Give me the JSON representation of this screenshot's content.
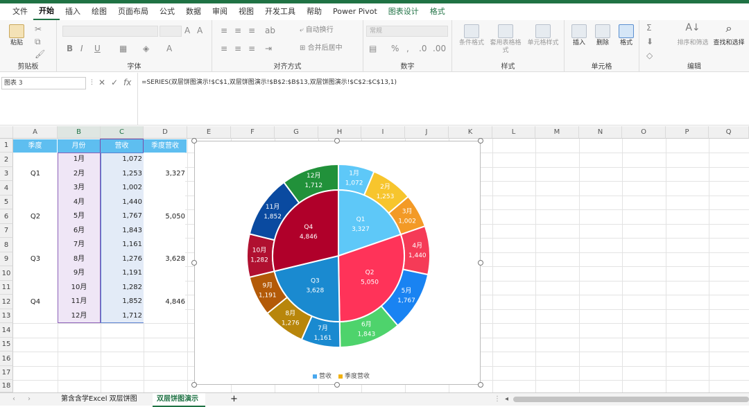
{
  "tabs": [
    "文件",
    "开始",
    "插入",
    "绘图",
    "页面布局",
    "公式",
    "数据",
    "审阅",
    "视图",
    "开发工具",
    "帮助",
    "Power Pivot",
    "图表设计",
    "格式"
  ],
  "active_tab": "开始",
  "ribbon": {
    "groups": [
      "剪贴板",
      "字体",
      "对齐方式",
      "数字",
      "样式",
      "单元格",
      "编辑"
    ],
    "paste_label": "粘贴",
    "wrap_text": "自动换行",
    "merge_center": "合并后居中",
    "number_format": "常规",
    "cond_format": "条件格式",
    "table_format": "套用表格格式",
    "cell_style": "单元格样式",
    "insert": "插入",
    "delete": "删除",
    "format": "格式",
    "sort_filter": "排序和筛选",
    "find_select": "查找和选择"
  },
  "formula_bar": {
    "name_box": "图表 3",
    "formula": "=SERIES(双层饼图演示!$C$1,双层饼图演示!$B$2:$B$13,双层饼图演示!$C$2:$C$13,1)"
  },
  "columns": [
    "A",
    "B",
    "C",
    "D",
    "E",
    "F",
    "G",
    "H",
    "I",
    "J",
    "K",
    "L",
    "M",
    "N",
    "O",
    "P",
    "Q"
  ],
  "rows": [
    "1",
    "2",
    "3",
    "4",
    "5",
    "6",
    "7",
    "8",
    "9",
    "10",
    "11",
    "12",
    "13",
    "14",
    "15",
    "16",
    "17",
    "18"
  ],
  "table": {
    "headers": [
      "季度",
      "月份",
      "营收",
      "季度营收"
    ],
    "months": [
      "1月",
      "2月",
      "3月",
      "4月",
      "5月",
      "6月",
      "7月",
      "8月",
      "9月",
      "10月",
      "11月",
      "12月"
    ],
    "revenue": [
      "1,072",
      "1,253",
      "1,002",
      "1,440",
      "1,767",
      "1,843",
      "1,161",
      "1,276",
      "1,191",
      "1,282",
      "1,852",
      "1,712"
    ],
    "quarters": [
      "Q1",
      "Q2",
      "Q3",
      "Q4"
    ],
    "quarter_revenue": [
      "3,327",
      "5,050",
      "3,628",
      "4,846"
    ]
  },
  "chart_data": {
    "type": "pie",
    "series": [
      {
        "name": "营收",
        "categories": [
          "1月",
          "2月",
          "3月",
          "4月",
          "5月",
          "6月",
          "7月",
          "8月",
          "9月",
          "10月",
          "11月",
          "12月"
        ],
        "values": [
          1072,
          1253,
          1002,
          1440,
          1767,
          1843,
          1161,
          1276,
          1191,
          1282,
          1852,
          1712
        ],
        "labels": [
          "1,072",
          "1,253",
          "1,002",
          "1,440",
          "1,767",
          "1,843",
          "1,161",
          "1,276",
          "1,191",
          "1,282",
          "1,852",
          "1,712"
        ]
      },
      {
        "name": "季度营收",
        "categories": [
          "Q1",
          "Q2",
          "Q3",
          "Q4"
        ],
        "values": [
          3327,
          5050,
          3628,
          4846
        ],
        "labels": [
          "3,327",
          "5,050",
          "3,628",
          "4,846"
        ]
      }
    ],
    "legend": [
      "营收",
      "季度营收"
    ],
    "legend_position": "bottom",
    "outer_colors": [
      "#5ec8f8",
      "#f7c52d",
      "#f39a26",
      "#f53b57",
      "#1983f2",
      "#4ed36c",
      "#1a8ad0",
      "#b8860b",
      "#b35a08",
      "#b01030",
      "#0a4aa0",
      "#21913a"
    ],
    "inner_colors": [
      "#5ec8f8",
      "#ff3359",
      "#1a8ad0",
      "#b0002a"
    ],
    "legend_colors": [
      "#4aa8ee",
      "#f2b20f"
    ]
  },
  "sheet_tabs": [
    "第含含学Excel 双层饼图",
    "双层饼图演示"
  ],
  "add_sheet": "+"
}
